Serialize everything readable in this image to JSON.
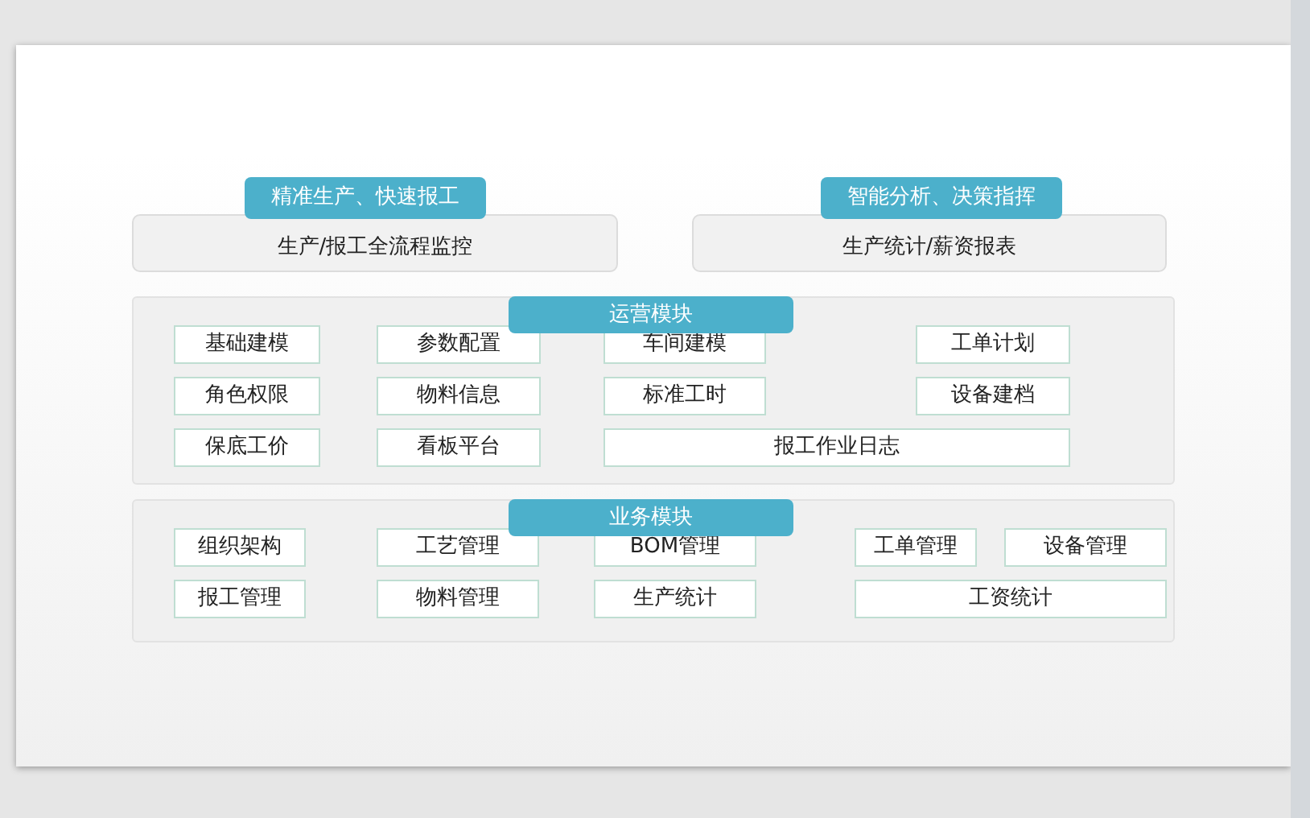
{
  "highlights": [
    {
      "tag": "精准生产、快速报工",
      "text": "生产/报工全流程监控"
    },
    {
      "tag": "智能分析、决策指挥",
      "text": "生产统计/薪资报表"
    }
  ],
  "modules": [
    {
      "title": "运营模块",
      "rows": [
        [
          "基础建模",
          "参数配置",
          "车间建模",
          "工单计划"
        ],
        [
          "角色权限",
          "物料信息",
          "标准工时",
          "设备建档"
        ],
        [
          "保底工价",
          "看板平台",
          "报工作业日志"
        ]
      ]
    },
    {
      "title": "业务模块",
      "rows": [
        [
          "组织架构",
          "工艺管理",
          "BOM管理",
          "工单管理",
          "设备管理"
        ],
        [
          "报工管理",
          "物料管理",
          "生产统计",
          "工资统计"
        ]
      ]
    }
  ]
}
